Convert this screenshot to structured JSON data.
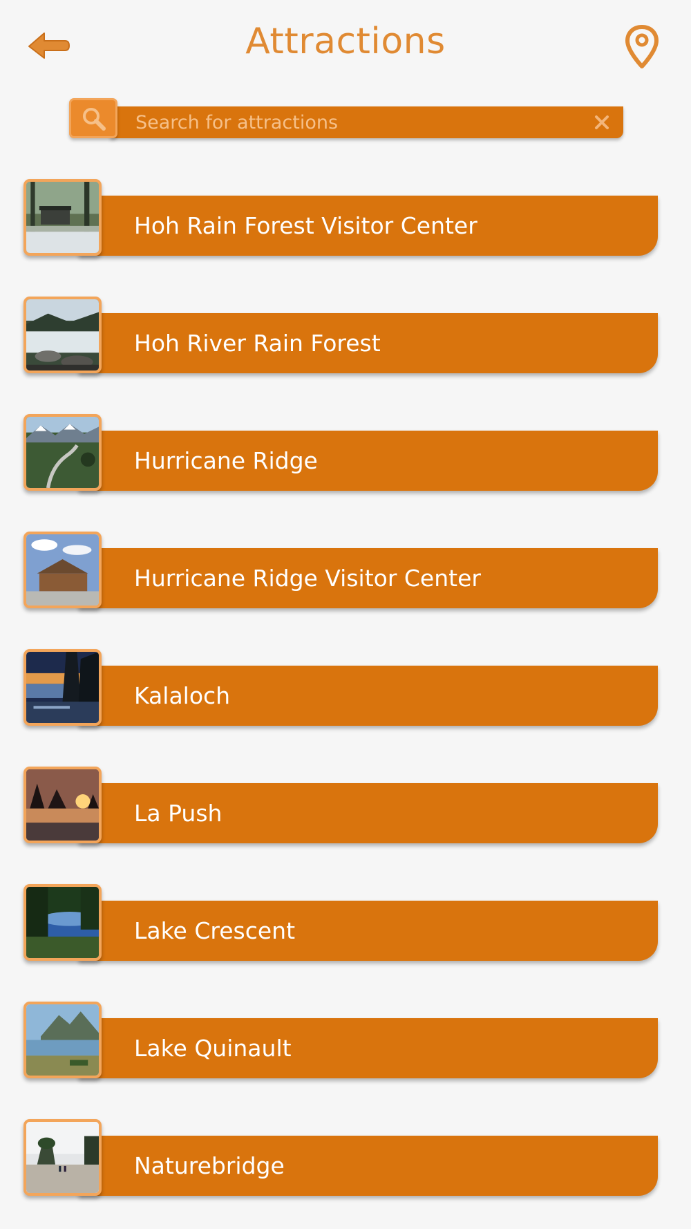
{
  "header": {
    "title": "Attractions",
    "back_icon": "back-arrow-icon",
    "map_icon": "map-pin-icon"
  },
  "search": {
    "placeholder": "Search for attractions",
    "value": "",
    "search_icon": "search-icon",
    "clear_icon": "clear-icon"
  },
  "colors": {
    "accent": "#d9740d",
    "title": "#e08a33",
    "thumb_border": "#f3a55a",
    "background": "#f6f6f6"
  },
  "attractions": [
    {
      "label": "Hoh Rain Forest Visitor Center",
      "image": "forest visitor center photo"
    },
    {
      "label": "Hoh River Rain Forest",
      "image": "river photo"
    },
    {
      "label": "Hurricane Ridge",
      "image": "mountain road photo"
    },
    {
      "label": "Hurricane Ridge Visitor Center",
      "image": "lodge photo"
    },
    {
      "label": "Kalaloch",
      "image": "coast at dusk photo"
    },
    {
      "label": "La Push",
      "image": "sunset sea stacks photo"
    },
    {
      "label": "Lake Crescent",
      "image": "lake photo"
    },
    {
      "label": "Lake Quinault",
      "image": "lake and mountains photo"
    },
    {
      "label": "Naturebridge",
      "image": "beach sea stack photo"
    }
  ]
}
